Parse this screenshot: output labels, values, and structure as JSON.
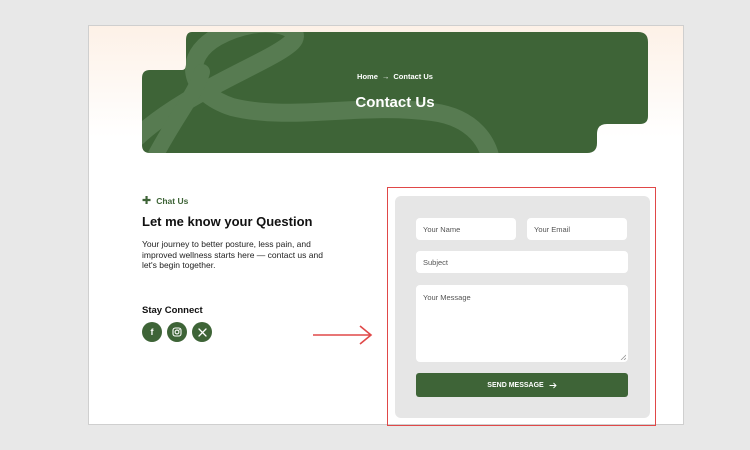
{
  "colors": {
    "brand_green": "#3e6437",
    "annotation_red": "#e04848"
  },
  "breadcrumb": {
    "home": "Home",
    "separator": "→",
    "current": "Contact Us"
  },
  "hero": {
    "title": "Contact Us"
  },
  "contact_info": {
    "eyebrow": "Chat Us",
    "eyebrow_icon": "plus-icon",
    "heading": "Let me know your Question",
    "description": "Your journey to better posture, less pain, and improved wellness starts here — contact us and let's begin together."
  },
  "social": {
    "title": "Stay Connect",
    "items": [
      {
        "icon": "facebook-icon",
        "glyph": "f"
      },
      {
        "icon": "instagram-icon",
        "glyph": "◎"
      },
      {
        "icon": "x-icon",
        "glyph": "𝕏"
      }
    ]
  },
  "form": {
    "name_placeholder": "Your Name",
    "email_placeholder": "Your Email",
    "subject_placeholder": "Subject",
    "message_placeholder": "Your Message",
    "submit_label": "SEND MESSAGE",
    "submit_icon": "arrow-right-icon"
  }
}
